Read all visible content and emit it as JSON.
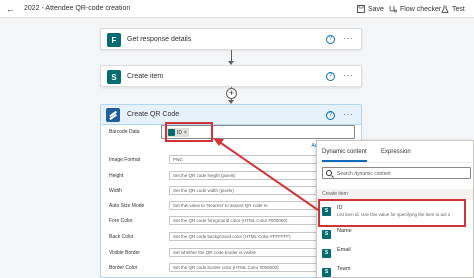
{
  "topbar": {
    "title": "2022 - Attendee QR-code creation",
    "save_label": "Save",
    "flow_checker_label": "Flow checker",
    "test_label": "Test"
  },
  "steps": [
    {
      "label": "Get response details",
      "icon": "forms-icon"
    },
    {
      "label": "Create item",
      "icon": "sharepoint-icon"
    }
  ],
  "qr_card": {
    "title": "Create QR Code",
    "barcode_label": "Barcode Data",
    "token_label": "ID",
    "token_remove": "×",
    "add_dynamic": "Add dy",
    "fields": [
      {
        "label": "Image Format",
        "value": "PNG"
      },
      {
        "label": "Height",
        "value": "Set the QR code height (pixels)"
      },
      {
        "label": "Width",
        "value": "Set the QR code width (pixels)"
      },
      {
        "label": "Auto Size Mode",
        "value": "Set this value to 'Nearest' to assure QR code re"
      },
      {
        "label": "Fore Color",
        "value": "Set the QR code foreground color (HTML Color #000000)"
      },
      {
        "label": "Back Color",
        "value": "Set the QR code background color (HTML Color #FFFFFF)"
      },
      {
        "label": "Visible Border",
        "value": "Set whether the QR code border is visible"
      },
      {
        "label": "Border Color",
        "value": "Set the QR code border color (HTML Color #000000)"
      }
    ]
  },
  "dynamic_panel": {
    "tab_dynamic": "Dynamic content",
    "tab_expression": "Expression",
    "search_placeholder": "Search dynamic content",
    "section": "Create item",
    "items": [
      {
        "name": "ID",
        "desc": "List item id. Use this value for specifying the item to act o"
      },
      {
        "name": "Name",
        "desc": ""
      },
      {
        "name": "Email",
        "desc": ""
      },
      {
        "name": "Team",
        "desc": ""
      }
    ]
  },
  "colors": {
    "accent": "#0f6cbd",
    "highlight_red": "#d13438",
    "sharepoint_teal": "#036c70"
  }
}
